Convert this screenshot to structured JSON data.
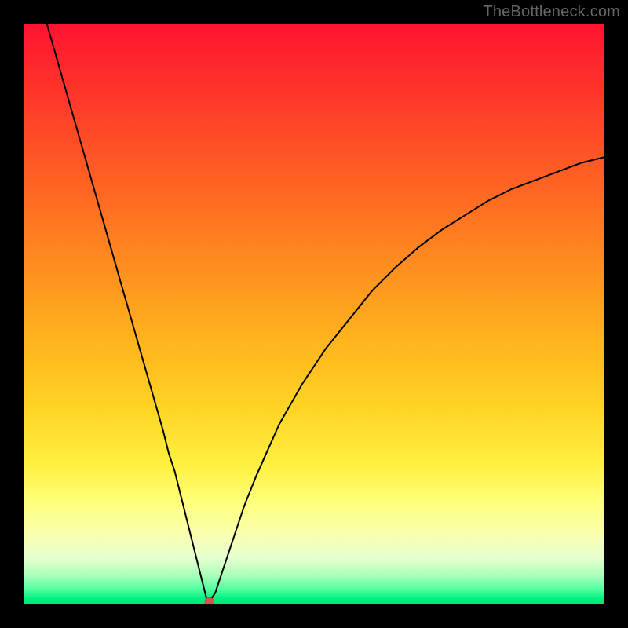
{
  "attribution": "TheBottleneck.com",
  "colors": {
    "frame": "#000000",
    "gradient_top": "#ff1430",
    "gradient_mid": "#ffd324",
    "gradient_bottom": "#00e676",
    "curve": "#000000",
    "marker": "#d9534f"
  },
  "chart_data": {
    "type": "line",
    "title": "",
    "xlabel": "",
    "ylabel": "",
    "xlim": [
      0,
      100
    ],
    "ylim": [
      0,
      100
    ],
    "grid": false,
    "legend": false,
    "series": [
      {
        "name": "bottleneck-curve",
        "x": [
          4,
          6,
          8,
          10,
          12,
          14,
          16,
          18,
          20,
          22,
          24,
          25,
          26,
          27,
          28,
          29,
          30,
          31,
          31.5,
          32,
          33,
          34,
          36,
          38,
          40,
          44,
          48,
          52,
          56,
          60,
          64,
          68,
          72,
          76,
          80,
          84,
          88,
          92,
          96,
          100
        ],
        "y": [
          100,
          93,
          86,
          79,
          72,
          65,
          58,
          51,
          44,
          37,
          30,
          26,
          23,
          19,
          15,
          11,
          7,
          3,
          1,
          0.5,
          2,
          5,
          11,
          17,
          22,
          31,
          38,
          44,
          49,
          54,
          58,
          61.5,
          64.5,
          67,
          69.5,
          71.5,
          73,
          74.5,
          76,
          77
        ]
      }
    ],
    "marker": {
      "x": 32,
      "y": 0.5
    }
  }
}
